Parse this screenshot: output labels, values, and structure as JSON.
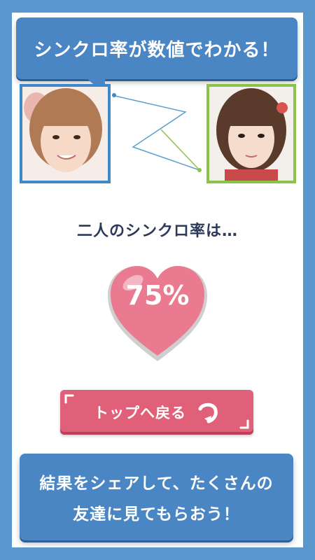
{
  "banner": {
    "text": "シンクロ率が数値でわかる！"
  },
  "result": {
    "label": "二人のシンクロ率は…",
    "percent": "75%"
  },
  "back_button": {
    "label": "トップへ戻る"
  },
  "share_button": {
    "line1": "結果をシェアして、たくさんの",
    "line2": "友達に見てもらおう！"
  },
  "colors": {
    "background": "#5b97cf",
    "banner": "#4a86c4",
    "left_frame": "#3f88c9",
    "right_frame": "#8bc34a",
    "heart": "#ea7a90",
    "back_button": "#e0607a"
  }
}
